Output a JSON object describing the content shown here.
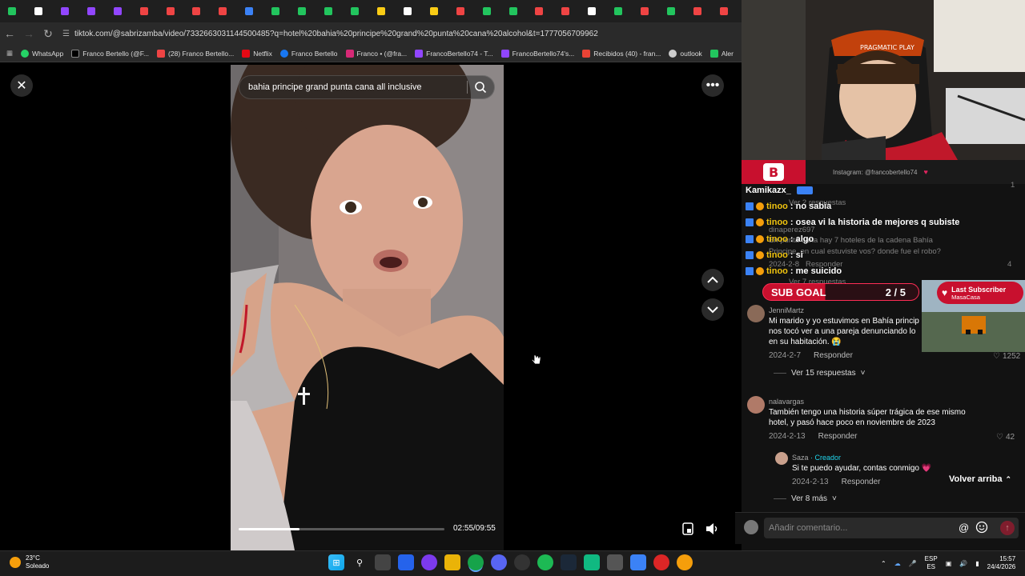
{
  "browser": {
    "url": "tiktok.com/@sabrizamba/video/7332663031144500485?q=hotel%20bahia%20principe%20grand%20punta%20cana%20alcohol&t=1777056709962",
    "bookmarks": [
      "WhatsApp",
      "Franco Bertello (@F...",
      "(28) Franco Bertello...",
      "Netflix",
      "Franco Bertello",
      "Franco • (@fra...",
      "FrancoBertello74 - T...",
      "FrancoBertello74's...",
      "Recibidos (40) - fran...",
      "outlook",
      "Aler"
    ],
    "tab_colors": [
      "#22c55e",
      "#ffffff",
      "#9146ff",
      "#9146ff",
      "#9146ff",
      "#ef4444",
      "#ef4444",
      "#ef4444",
      "#ef4444",
      "#3b82f6",
      "#22c55e",
      "#22c55e",
      "#22c55e",
      "#22c55e",
      "#facc15",
      "#ffffff",
      "#facc15",
      "#ef4444",
      "#22c55e",
      "#22c55e",
      "#ef4444",
      "#ef4444",
      "#ffffff",
      "#22c55e",
      "#ef4444",
      "#22c55e",
      "#ef4444",
      "#ef4444"
    ]
  },
  "tiktok": {
    "search_text": "bahia principe grand punta cana all inclusive",
    "time": "02:55/09:55",
    "progress": 0.295
  },
  "stream": {
    "instagram": "Instagram: @francobertello74",
    "chat": [
      {
        "user": "Kamikazx_",
        "text": ""
      },
      {
        "user": "tinoo",
        "text": ": no sabia"
      },
      {
        "user": "tinoo",
        "text": ": osea vi la historia de mejores q subiste"
      },
      {
        "user": "tinoo",
        "text": ": algo"
      },
      {
        "user": "tinoo",
        "text": ": si"
      },
      {
        "user": "tinoo",
        "text": ": me suicido"
      }
    ],
    "sub_goal_label": "SUB GOAL",
    "sub_goal_value": "2 / 5",
    "last_sub_title": "Last Subscriber",
    "last_sub_name": "MasaCasa"
  },
  "ghost": {
    "g1": "Ver 2 respuestas",
    "g2": "dinaperez697",
    "g3": "En punta cana hay 7 hoteles de la cadena Bahía",
    "g4": "Principe, en cual estuviste vos? donde fue el robo?",
    "g5": "2024-2-8",
    "g6": "Responder",
    "g7": "4",
    "g8": "Ver 7 respuestas",
    "g9": "1"
  },
  "comments": {
    "c1": {
      "user": "JenniMartz",
      "text1": "Mi marido y yo estuvimos en Bahía princip",
      "text2": "nos tocó ver a una pareja denunciando lo",
      "text3": "en su habitación. 😭",
      "date": "2024-2-7",
      "reply": "Responder",
      "likes": "1252",
      "more": "Ver 15 respuestas"
    },
    "c2": {
      "user": "nalavargas",
      "text1": "También tengo una historia súper trágica de ese mismo",
      "text2": "hotel, y pasó hace poco en noviembre de 2023",
      "date": "2024-2-13",
      "reply": "Responder",
      "likes": "42"
    },
    "c3": {
      "user": "Saza",
      "creator": "· Creador",
      "text": "Si te puedo ayudar, contas conmigo 💗",
      "date": "2024-2-13",
      "reply": "Responder",
      "more": "Ver 8 más"
    },
    "back_top": "Volver arriba",
    "input_placeholder": "Añadir comentario..."
  },
  "taskbar": {
    "temp": "23°C",
    "weather": "Soleado",
    "lang1": "ESP",
    "lang2": "ES",
    "time": "15:57",
    "date": "24/4/2026"
  }
}
